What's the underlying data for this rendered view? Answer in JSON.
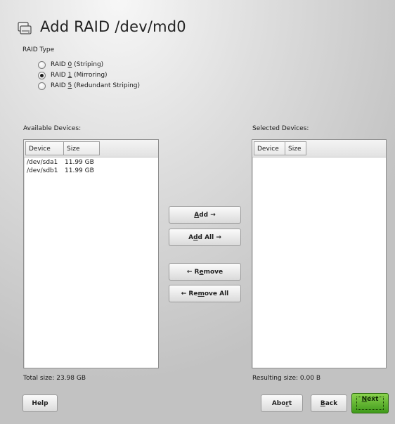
{
  "header": {
    "title": "Add RAID /dev/md0",
    "icon": "hard-drive-icon"
  },
  "raid_type": {
    "label": "RAID Type",
    "options": [
      {
        "prefix": "RAID ",
        "key": "0",
        "suffix": " (Striping)",
        "selected": false
      },
      {
        "prefix": "RAID ",
        "key": "1",
        "suffix": " (Mirroring)",
        "selected": true
      },
      {
        "prefix": "RAID ",
        "key": "5",
        "suffix": " (Redundant Striping)",
        "selected": false
      }
    ]
  },
  "available": {
    "label": "Available Devices:",
    "columns": [
      "Device",
      "Size"
    ],
    "rows": [
      {
        "device": "/dev/sda1",
        "size": "11.99 GB"
      },
      {
        "device": "/dev/sdb1",
        "size": "11.99 GB"
      }
    ],
    "total": "Total size: 23.98 GB"
  },
  "selected": {
    "label": "Selected Devices:",
    "columns": [
      "Device",
      "Size"
    ],
    "rows": [],
    "total": "Resulting size: 0.00 B"
  },
  "buttons": {
    "add": {
      "key": "A",
      "rest": "dd →"
    },
    "add_all": {
      "pre": "A",
      "key": "d",
      "rest": "d All →"
    },
    "remove": {
      "pre": "← R",
      "key": "e",
      "rest": "move"
    },
    "remove_all": {
      "pre": "← Re",
      "key": "m",
      "rest": "ove All"
    },
    "help": "Help",
    "abort": {
      "pre": "Abo",
      "key": "r",
      "rest": "t"
    },
    "back": {
      "key": "B",
      "rest": "ack"
    },
    "next": {
      "key": "N",
      "rest": "ext"
    }
  }
}
